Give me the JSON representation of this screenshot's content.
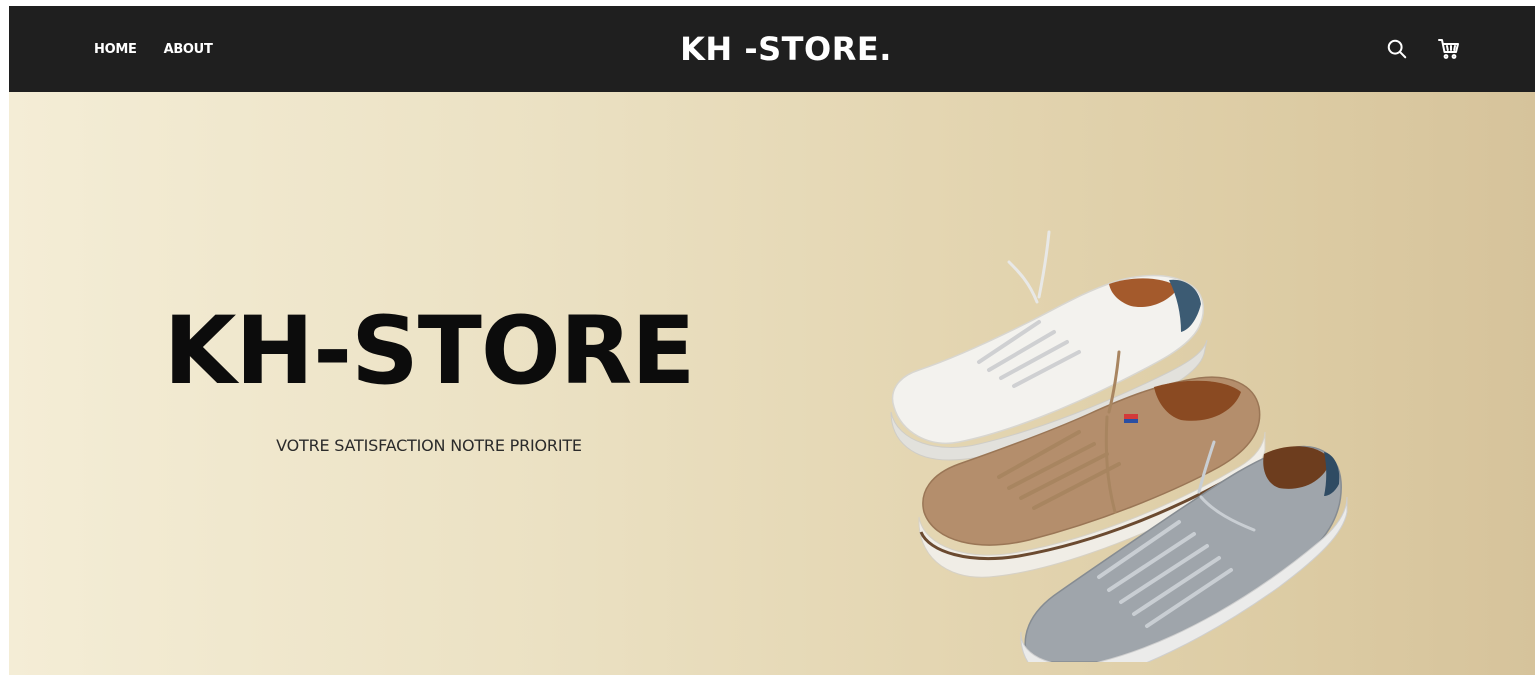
{
  "header": {
    "nav": [
      {
        "label": "HOME"
      },
      {
        "label": "ABOUT"
      }
    ],
    "brand": "KH -STORE.",
    "icons": [
      "search-icon",
      "cart-icon"
    ]
  },
  "hero": {
    "title": "KH-STORE",
    "subtitle": "VOTRE SATISFACTION NOTRE PRIORITE",
    "image": "three-sneakers-white-tan-grey"
  },
  "colors": {
    "navbar": "#1f1f1f",
    "nav_text": "#ffffff",
    "hero_gradient_start": "#f4edd6",
    "hero_gradient_end": "#d6c39b",
    "title_text": "#0c0c0c"
  }
}
